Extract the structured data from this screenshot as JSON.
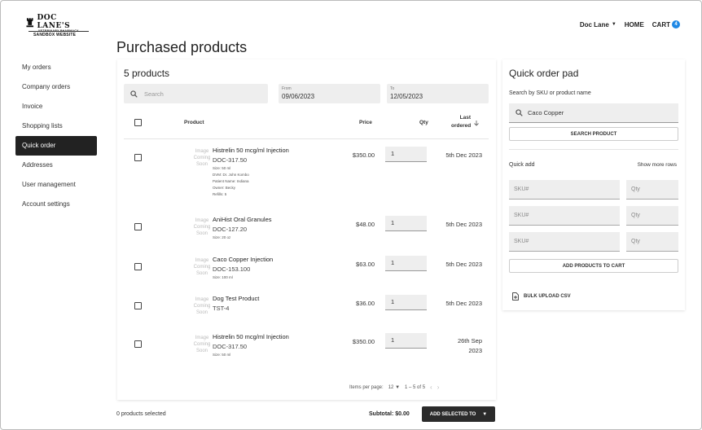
{
  "brand": {
    "name": "DOC LANE'S",
    "tagline": "VETERINARY PHARMACY",
    "subtitle": "SANDBOX WEBSITE"
  },
  "topnav": {
    "user": "Doc Lane",
    "home": "HOME",
    "cart": "CART",
    "cart_count": "4"
  },
  "page_title": "Purchased products",
  "sidebar": {
    "items": [
      {
        "label": "My orders",
        "active": false
      },
      {
        "label": "Company orders",
        "active": false
      },
      {
        "label": "Invoice",
        "active": false
      },
      {
        "label": "Shopping lists",
        "active": false
      },
      {
        "label": "Quick order",
        "active": true
      },
      {
        "label": "Addresses",
        "active": false
      },
      {
        "label": "User management",
        "active": false
      },
      {
        "label": "Account settings",
        "active": false
      }
    ]
  },
  "products": {
    "count_label": "5 products",
    "search_placeholder": "Search",
    "from_label": "From",
    "from_value": "09/06/2023",
    "to_label": "To",
    "to_value": "12/05/2023",
    "columns": {
      "product": "Product",
      "price": "Price",
      "qty": "Qty",
      "last_ordered_1": "Last",
      "last_ordered_2": "ordered"
    },
    "image_placeholder": [
      "Image",
      "Coming",
      "Soon"
    ],
    "rows": [
      {
        "name": "Histrelin 50 mcg/ml Injection",
        "sku": "DOC-317.50",
        "meta": [
          "Size: 50 ml",
          "DVM: Dr. John Kombo",
          "Patient Name: Indiana",
          "Owner: Becky",
          "Refills: 5"
        ],
        "price": "$350.00",
        "qty": "1",
        "date_1": "5th Dec 2023",
        "date_2": ""
      },
      {
        "name": "AniHist Oral Granules",
        "sku": "DOC-127.20",
        "meta": [
          "Size: 20 oz"
        ],
        "price": "$48.00",
        "qty": "1",
        "date_1": "5th Dec 2023",
        "date_2": ""
      },
      {
        "name": "Caco Copper Injection",
        "sku": "DOC-153.100",
        "meta": [
          "Size: 100 ml"
        ],
        "price": "$63.00",
        "qty": "1",
        "date_1": "5th Dec 2023",
        "date_2": ""
      },
      {
        "name": "Dog Test Product",
        "sku": "TST-4",
        "meta": [],
        "price": "$36.00",
        "qty": "1",
        "date_1": "5th Dec 2023",
        "date_2": ""
      },
      {
        "name": "Histrelin 50 mcg/ml Injection",
        "sku": "DOC-317.50",
        "meta": [
          "Size: 50 ml"
        ],
        "price": "$350.00",
        "qty": "1",
        "date_1": "26th Sep",
        "date_2": "2023"
      }
    ],
    "pager": {
      "items_per_page_label": "Items per page:",
      "items_per_page": "12",
      "range": "1 – 5 of 5",
      "prev": "‹",
      "next": "›"
    }
  },
  "footer": {
    "selected": "0 products selected",
    "subtotal": "Subtotal: $0.00",
    "add_selected": "ADD SELECTED TO"
  },
  "quick_order_pad": {
    "title": "Quick order pad",
    "search_label": "Search by SKU or product name",
    "search_value": "Caco Copper",
    "search_button": "SEARCH PRODUCT",
    "quick_add_label": "Quick add",
    "show_more": "Show more rows",
    "sku_placeholder": "SKU#",
    "qty_placeholder": "Qty",
    "add_to_cart": "ADD PRODUCTS TO CART",
    "bulk_upload": "BULK UPLOAD CSV"
  }
}
